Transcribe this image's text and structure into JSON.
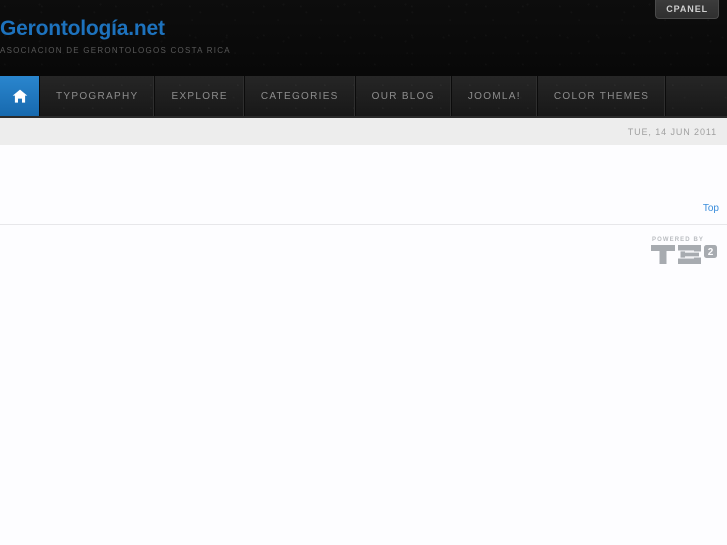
{
  "header": {
    "cpanel_label": "CPANEL",
    "logo_title": "Gerontología.net",
    "logo_slogan": "ASOCIACION DE GERONTOLOGOS COSTA RICA",
    "logo_color": "#1d72bd",
    "background_color": "#0b0b0b"
  },
  "nav": {
    "accent_color": "#1d72bd",
    "items": [
      {
        "label": "",
        "icon": "home-icon",
        "active": true
      },
      {
        "label": "TYPOGRAPHY",
        "icon": "",
        "active": false
      },
      {
        "label": "EXPLORE",
        "icon": "",
        "active": false
      },
      {
        "label": "CATEGORIES",
        "icon": "",
        "active": false
      },
      {
        "label": "OUR BLOG",
        "icon": "",
        "active": false
      },
      {
        "label": "JOOMLA!",
        "icon": "",
        "active": false
      },
      {
        "label": "COLOR THEMES",
        "icon": "",
        "active": false
      }
    ]
  },
  "datebar": {
    "date": "TUE, 14 JUN 2011",
    "background_color": "#ededed"
  },
  "footer": {
    "top_link": "Top",
    "top_link_color": "#3a8ddb",
    "t3_powered_by": "POWERED BY",
    "t3_mark": "T3",
    "t3_version": "2",
    "t3_color": "#a7abb0"
  }
}
